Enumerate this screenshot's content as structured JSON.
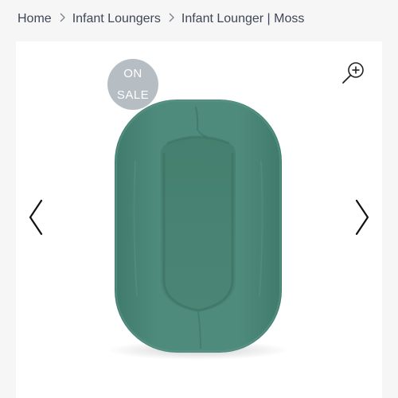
{
  "breadcrumb": {
    "items": [
      "Home",
      "Infant Loungers",
      "Infant Lounger | Moss"
    ],
    "separator": ">"
  },
  "gallery": {
    "badge_line1": "ON",
    "badge_line2": "SALE",
    "zoom_icon": "zoom-in-icon",
    "prev_icon": "chevron-left-icon",
    "next_icon": "chevron-right-icon"
  },
  "colors": {
    "product_green": "#4f8b7d",
    "badge_gray": "#b6bdc3",
    "breadcrumb_text": "#3f4656"
  }
}
